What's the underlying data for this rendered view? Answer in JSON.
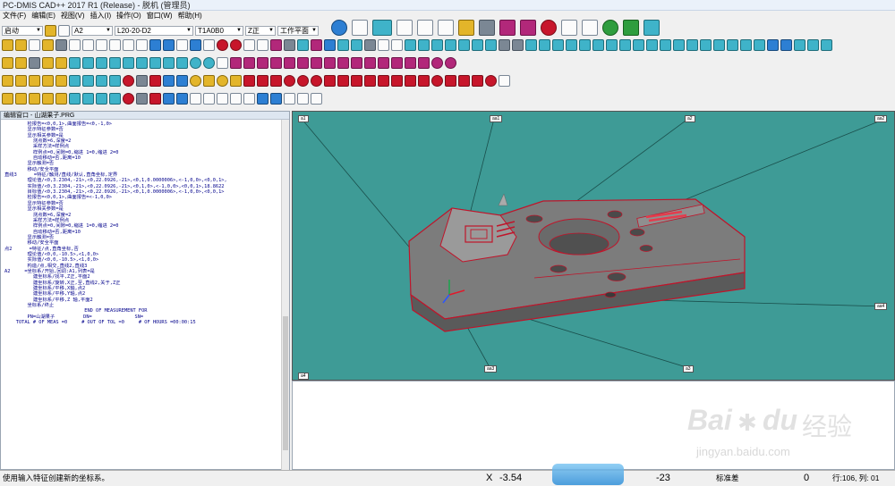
{
  "window_title": "PC-DMIS CAD++ 2017 R1 (Release) - 脱机 (管理员)",
  "menu": [
    "文件(F)",
    "编辑(E)",
    "视图(V)",
    "插入(I)",
    "操作(O)",
    "窗口(W)",
    "帮助(H)"
  ],
  "toolbar": {
    "mode_select": "启动",
    "probe_select": "A2",
    "tip_select": "L20-20-D2",
    "tip_name": "T1A0B0",
    "plane_select": "Z正",
    "work_plane": "工作平面"
  },
  "editor": {
    "title": "编辑窗口 - 山湖果子.PRG",
    "lines": [
      "        检报告=<0,0,1>,曲面报告=<0,-1,0>",
      "        显示特征参数=否",
      "        显示相关参数=是",
      "          测点数=6,深度=2",
      "          采样方法=样例点",
      "          样例点=0,间隙=0,缩进 1=0,缩进 2=0",
      "          自动移动=否,距离=10",
      "        显示触测=否",
      "        移动/安全平面",
      "直线3      =特征/触测/直线/默认,直角坐标,定界",
      "        理论值/<0,3.2304,-21>,<0,22.0926,-21>,<0,1,0.0000006>,<-1,0,0>,<0,0,1>,",
      "        实际值/<0,3.2304,-21>,<0,22.0926,-21>,<0,1,0>,<-1,0,0>,<0,0,1>,18.8622",
      "        目标值/<0,3.2304,-21>,<0,22.0926,-21>,<0,1,0.0000006>,<-1,0,0>,<0,0,1>",
      "        检报告=<0,0,1>,曲面报告=<-1,0,0>",
      "        显示特征参数=否",
      "        显示相关参数=是",
      "          测点数=6,深度=2",
      "          采样方法=样例点",
      "          样例点=0,间隙=0,缩进 1=0,缩进 2=0",
      "          自动移动=否,距离=10",
      "        显示触测=否",
      "        移动/安全平面",
      "点2      =特征/点,直角坐标,否",
      "        理论值/<0,0,-10.5>,<1,0,0>",
      "        实际值/<0,0,-10.5>,<1,0,0>",
      "        构造/点,相交,直线2,直线3",
      "A2     =坐标系/开始,回调:A1,列表=是",
      "          建坐标系/找平,Z正,平面2",
      "          建坐标系/旋转,X正,至,直线2,关于,Z正",
      "          建坐标系/平移,X轴,点2",
      "          建坐标系/平移,Y轴,点2",
      "          建坐标系/平移,Z 轴,平面2",
      "        坐标系/终止",
      "                            END OF MEASUREMENT FOR",
      "        PN=山湖果子          DN=               SN=",
      "    TOTAL # OF MEAS =0     # OUT OF TOL =0     # OF HOURS =00:00:15"
    ]
  },
  "view_labels": [
    "a1",
    "aa1",
    "a2",
    "aa2",
    "a4",
    "aa3",
    "a3",
    "aa4"
  ],
  "status": {
    "hint": "使用输入特征创建新的坐标系。",
    "x_label": "X",
    "x_value": "-3.54",
    "z_value": "-23",
    "std_label": "标准差",
    "std_value": "0",
    "line_info": "行:106, 列: 01"
  },
  "watermark": {
    "baidu": "Bai",
    "du": "du",
    "jingyan": "经验",
    "url": "jingyan.baidu.com"
  },
  "colors": {
    "viewport_bg": "#3e9b96",
    "part": "#8a8a8a",
    "edge": "#c0142a"
  }
}
